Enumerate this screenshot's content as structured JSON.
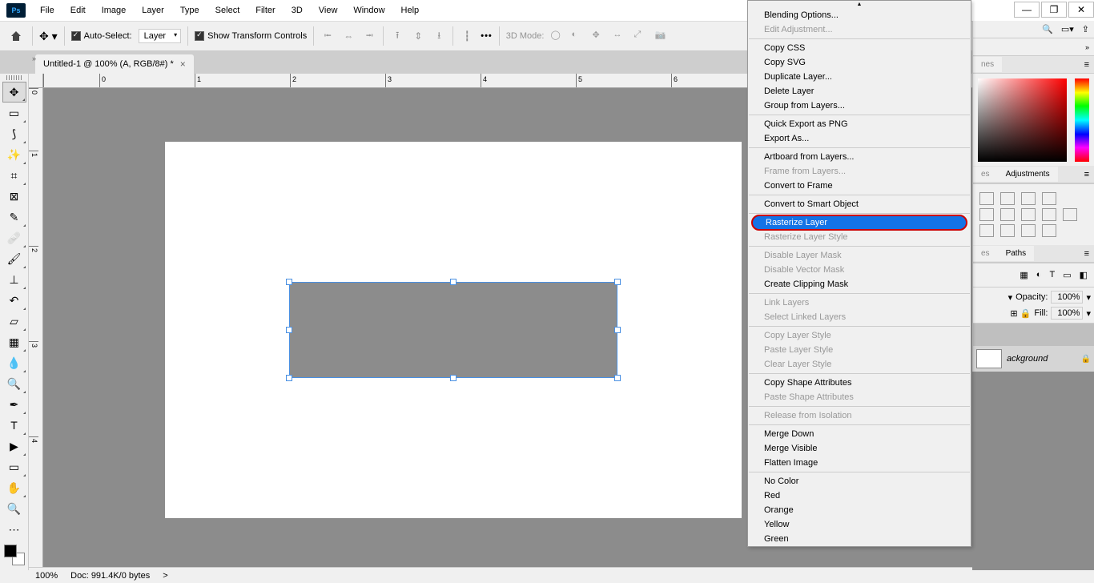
{
  "menu": [
    "File",
    "Edit",
    "Image",
    "Layer",
    "Type",
    "Select",
    "Filter",
    "3D",
    "View",
    "Window",
    "Help"
  ],
  "options": {
    "auto_select": "Auto-Select:",
    "layer_dd": "Layer",
    "transform": "Show Transform Controls",
    "mode3d": "3D Mode:"
  },
  "tab": {
    "title": "Untitled-1 @ 100% (A, RGB/8#) *"
  },
  "ruler_h": [
    "",
    "",
    "0",
    "",
    "1",
    "",
    "2",
    "",
    "3",
    "",
    "4",
    "",
    "5",
    "",
    "6"
  ],
  "ruler_v": [
    "0",
    "",
    "1",
    "",
    "2",
    "",
    "3",
    "",
    "4"
  ],
  "context": {
    "scroll": "▲",
    "groups": [
      [
        {
          "t": "Blending Options...",
          "d": false
        },
        {
          "t": "Edit Adjustment...",
          "d": true
        }
      ],
      [
        {
          "t": "Copy CSS",
          "d": false
        },
        {
          "t": "Copy SVG",
          "d": false
        },
        {
          "t": "Duplicate Layer...",
          "d": false
        },
        {
          "t": "Delete Layer",
          "d": false
        },
        {
          "t": "Group from Layers...",
          "d": false
        }
      ],
      [
        {
          "t": "Quick Export as PNG",
          "d": false
        },
        {
          "t": "Export As...",
          "d": false
        }
      ],
      [
        {
          "t": "Artboard from Layers...",
          "d": false
        },
        {
          "t": "Frame from Layers...",
          "d": true
        },
        {
          "t": "Convert to Frame",
          "d": false
        }
      ],
      [
        {
          "t": "Convert to Smart Object",
          "d": false
        }
      ],
      [
        {
          "t": "Rasterize Layer",
          "d": false,
          "hl": true
        },
        {
          "t": "Rasterize Layer Style",
          "d": true
        }
      ],
      [
        {
          "t": "Disable Layer Mask",
          "d": true
        },
        {
          "t": "Disable Vector Mask",
          "d": true
        },
        {
          "t": "Create Clipping Mask",
          "d": false
        }
      ],
      [
        {
          "t": "Link Layers",
          "d": true
        },
        {
          "t": "Select Linked Layers",
          "d": true
        }
      ],
      [
        {
          "t": "Copy Layer Style",
          "d": true
        },
        {
          "t": "Paste Layer Style",
          "d": true
        },
        {
          "t": "Clear Layer Style",
          "d": true
        }
      ],
      [
        {
          "t": "Copy Shape Attributes",
          "d": false
        },
        {
          "t": "Paste Shape Attributes",
          "d": true
        }
      ],
      [
        {
          "t": "Release from Isolation",
          "d": true
        }
      ],
      [
        {
          "t": "Merge Down",
          "d": false
        },
        {
          "t": "Merge Visible",
          "d": false
        },
        {
          "t": "Flatten Image",
          "d": false
        }
      ],
      [
        {
          "t": "No Color",
          "d": false
        },
        {
          "t": "Red",
          "d": false
        },
        {
          "t": "Orange",
          "d": false
        },
        {
          "t": "Yellow",
          "d": false
        },
        {
          "t": "Green",
          "d": false
        }
      ]
    ]
  },
  "panels": {
    "adjustments": "Adjustments",
    "add_adjustment_hint": "nes",
    "paths": "Paths",
    "layers_stub": "es",
    "opacity_label": "Opacity:",
    "opacity_val": "100%",
    "fill_label": "Fill:",
    "fill_val": "100%",
    "layer_name": "ackground"
  },
  "status": {
    "zoom": "100%",
    "doc": "Doc: 991.4K/0 bytes",
    "arrow": ">"
  }
}
